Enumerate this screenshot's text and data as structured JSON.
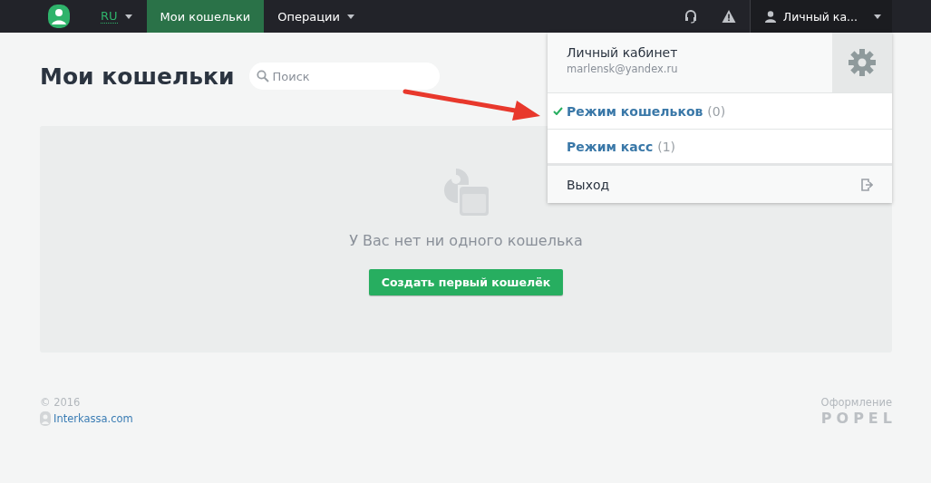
{
  "navbar": {
    "language": {
      "label": "RU"
    },
    "items": [
      {
        "label": "Мои кошельки",
        "selected": true,
        "dropdown": false
      },
      {
        "label": "Операции",
        "selected": false,
        "dropdown": true
      }
    ],
    "user_menu": {
      "label": "Личный ка...",
      "expanded": true
    }
  },
  "account_menu": {
    "title": "Личный кабинет",
    "email": "marlensk@yandex.ru",
    "modes": [
      {
        "name": "Режим кошельков",
        "count": "(0)",
        "selected": true
      },
      {
        "name": "Режим касс",
        "count": "(1)",
        "selected": false
      }
    ],
    "logout": "Выход"
  },
  "page": {
    "heading": "Мои кошельки",
    "search": {
      "placeholder": "Поиск"
    },
    "empty_message": "У Вас нет ни одного кошелька",
    "create_button": "Создать первый кошелёк"
  },
  "footer": {
    "copyright": "© 2016",
    "link": "Interkassa.com",
    "credit_label": "Оформление",
    "credit_brand": "POPEL"
  }
}
